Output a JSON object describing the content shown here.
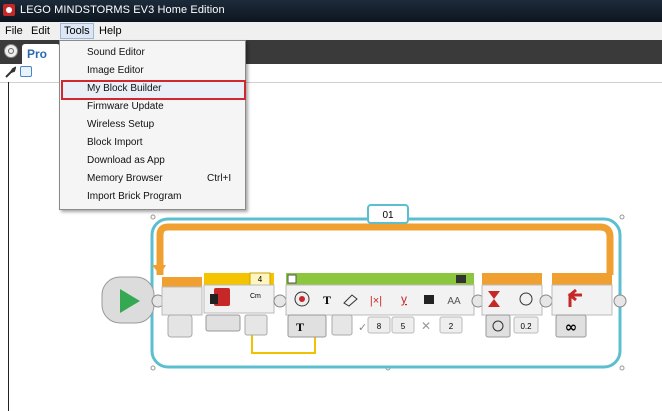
{
  "window": {
    "title": "LEGO MINDSTORMS EV3 Home Edition"
  },
  "menubar": {
    "items": [
      "File",
      "Edit",
      "Tools",
      "Help"
    ]
  },
  "appbar": {
    "project_tab": "Pro"
  },
  "tools_menu": {
    "items": [
      {
        "label": "Sound Editor",
        "shortcut": ""
      },
      {
        "label": "Image Editor",
        "shortcut": ""
      },
      {
        "label": "My Block Builder",
        "shortcut": ""
      },
      {
        "label": "Firmware Update",
        "shortcut": ""
      },
      {
        "label": "Wireless Setup",
        "shortcut": ""
      },
      {
        "label": "Block Import",
        "shortcut": ""
      },
      {
        "label": "Download as App",
        "shortcut": ""
      },
      {
        "label": "Memory Browser",
        "shortcut": "Ctrl+I"
      },
      {
        "label": "Import Brick Program",
        "shortcut": ""
      }
    ],
    "highlighted": "My Block Builder",
    "highlight_color": "#d0282f"
  },
  "program": {
    "loop_label": "01",
    "motor_port": "4",
    "motor_unit": "Cm",
    "display_values": [
      "8",
      "5",
      "2"
    ],
    "wait_value": "0.2",
    "loop_mode_symbol": "∞",
    "display_text_symbol": "T",
    "font_symbol": "AA",
    "colors": {
      "loop_border": "#5bbfd0",
      "loop_arc": "#f0a030",
      "start": "#34a853",
      "action": "#f5c400",
      "display": "#8cc63f",
      "flow": "#f0a030",
      "control": "#f0a030",
      "wire": "#f2c200"
    }
  }
}
